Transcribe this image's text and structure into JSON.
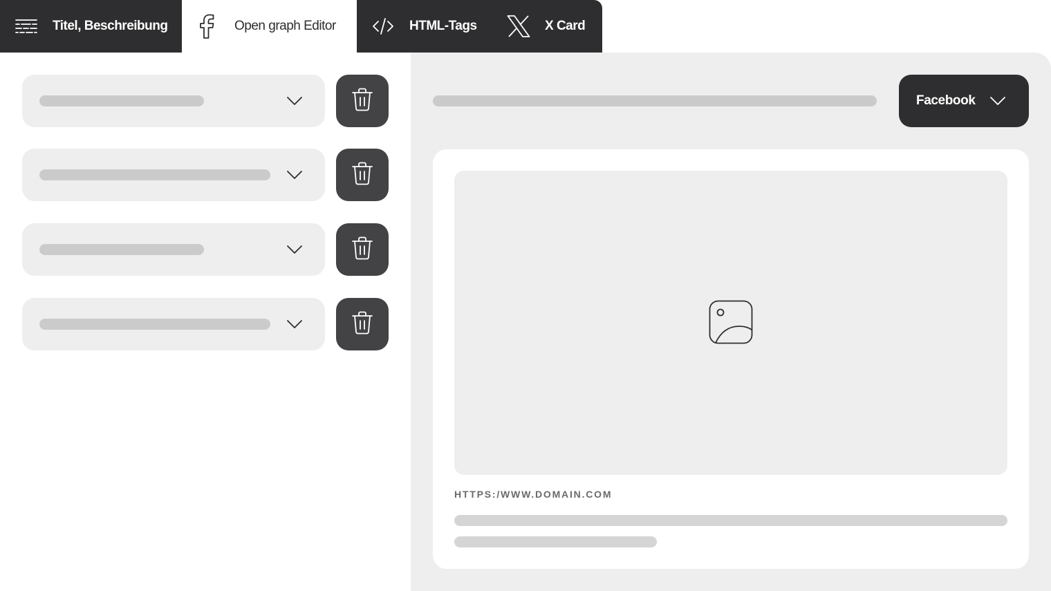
{
  "tabs": [
    {
      "label": "Titel, Beschreibung",
      "icon": "text-lines-icon",
      "active": false
    },
    {
      "label": "Open graph Editor",
      "icon": "facebook-icon",
      "active": true
    },
    {
      "label": "HTML-Tags",
      "icon": "code-icon",
      "active": false
    },
    {
      "label": "X Card",
      "icon": "x-logo-icon",
      "active": false
    }
  ],
  "rows": [
    {
      "placeholder": "skeleton-short",
      "action": "trash-icon"
    },
    {
      "placeholder": "skeleton-long",
      "action": "trash-icon"
    },
    {
      "placeholder": "skeleton-short",
      "action": "trash-icon"
    },
    {
      "placeholder": "skeleton-long",
      "action": "trash-icon"
    }
  ],
  "preview": {
    "platform_label": "Facebook",
    "image_icon": "image-icon",
    "domain": "HTTPS:/WWW.DOMAIN.COM"
  },
  "colors": {
    "dark": "#2e2e30",
    "button_dark": "#434345",
    "panel_bg": "#eeeeee",
    "skeleton": "#cbcbcb",
    "white": "#ffffff"
  }
}
